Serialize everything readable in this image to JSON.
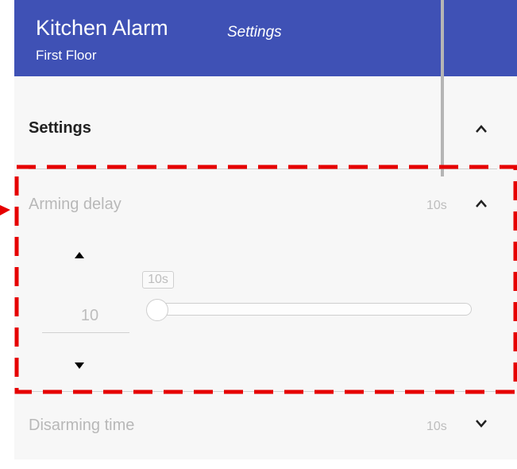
{
  "header": {
    "title": "Kitchen Alarm",
    "subtitle": "Settings",
    "location": "First Floor"
  },
  "section": {
    "title": "Settings"
  },
  "arming_delay": {
    "label": "Arming delay",
    "value": "10s",
    "number": "10",
    "slider_tooltip": "10s",
    "slider_position": 0
  },
  "disarming_time": {
    "label": "Disarming time",
    "value": "10s"
  },
  "colors": {
    "header": "#3f51b5",
    "highlight": "#e60000",
    "panel": "#f7f7f7"
  }
}
